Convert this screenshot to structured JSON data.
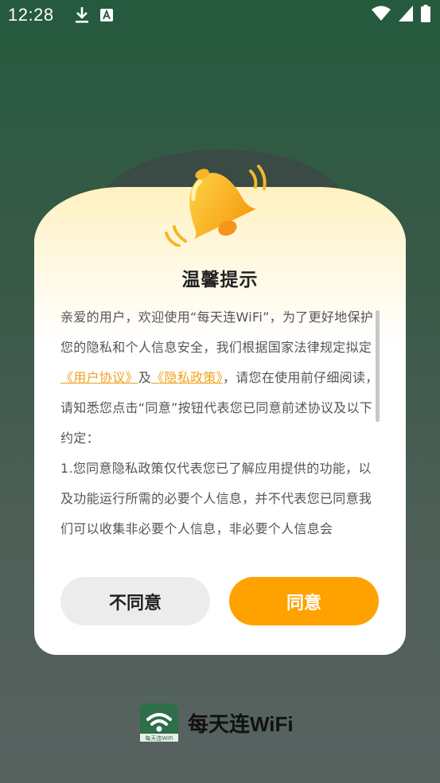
{
  "status_bar": {
    "time": "12:28",
    "icons": [
      "download-icon",
      "a-notification-icon",
      "wifi-icon",
      "signal-icon",
      "battery-icon"
    ]
  },
  "dialog": {
    "title": "温馨提示",
    "paragraph1_prefix": "亲爱的用户，欢迎使用“每天连WiFi”，为了更好地保护您的隐私和个人信息安全，我们根据国家法律规定拟定",
    "user_agreement_link": "《用户协议》",
    "conjunction": "及",
    "privacy_policy_link": "《隐私政策》",
    "paragraph1_suffix": "，请您在使用前仔细阅读，请知悉您点击“同意”按钮代表您已同意前述协议及以下约定：",
    "paragraph2": "1.您同意隐私政策仅代表您已了解应用提供的功能，以及功能运行所需的必要个人信息，并不代表您已同意我们可以收集非必要个人信息，非必要个人信息会",
    "decline_label": "不同意",
    "agree_label": "同意"
  },
  "brand": {
    "logo_caption": "每天连WiFi",
    "name": "每天连WiFi"
  },
  "colors": {
    "accent": "#ffa200",
    "link": "#f2a01a",
    "background_top": "#255a3e",
    "background_bottom": "#586361"
  }
}
